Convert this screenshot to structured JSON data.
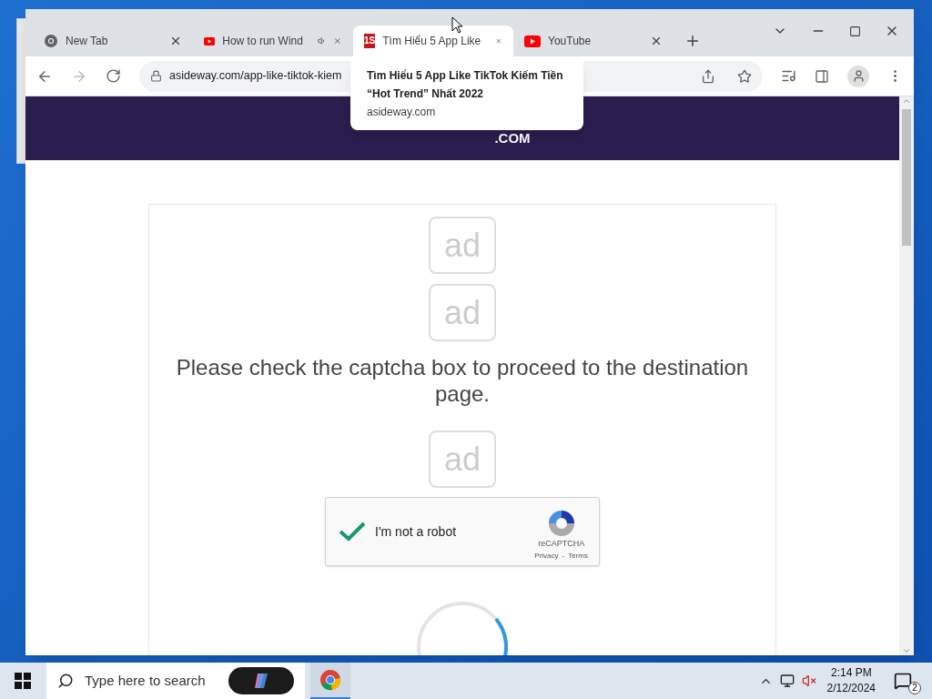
{
  "tabs": [
    {
      "title": "New Tab",
      "kind": "chrome",
      "selected": false,
      "audio": false
    },
    {
      "title": "How to run Wind",
      "kind": "youtube",
      "selected": false,
      "audio": true
    },
    {
      "title": "Tìm Hiểu 5 App Like",
      "kind": "site",
      "selected": true,
      "audio": false
    },
    {
      "title": "YouTube",
      "kind": "youtube",
      "selected": false,
      "audio": false
    }
  ],
  "site_icon_text": "1S",
  "address": "asideway.com/app-like-tiktok-kiem",
  "tooltip": {
    "title": "Tìm Hiểu 5 App Like TikTok Kiếm Tiền “Hot Trend” Nhất 2022",
    "domain": "asideway.com"
  },
  "header": {
    "logo_suffix": ".COM"
  },
  "ads": [
    {
      "label": "ad"
    },
    {
      "label": "ad"
    },
    {
      "label": "ad"
    }
  ],
  "message": "Please check the captcha box to proceed to the destination page.",
  "captcha": {
    "label": "I'm not a robot",
    "checked": true,
    "brand": "reCAPTCHA",
    "privacy": "Privacy",
    "separator": "-",
    "terms": "Terms"
  },
  "taskbar": {
    "search_placeholder": "Type here to search",
    "time": "2:14 PM",
    "date": "2/12/2024",
    "notifications": "2"
  }
}
